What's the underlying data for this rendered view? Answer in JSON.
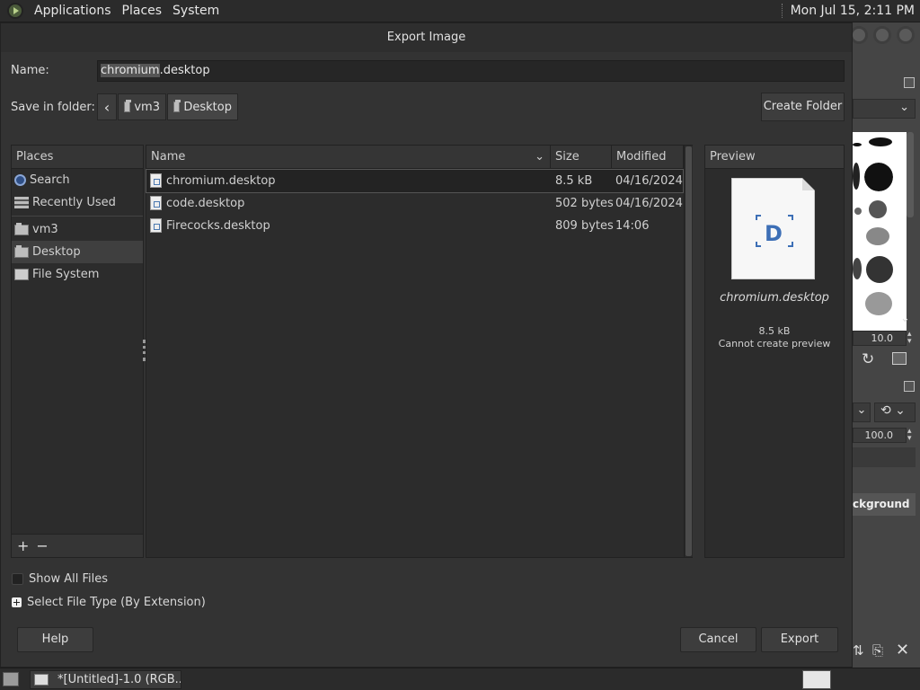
{
  "top_panel": {
    "menus": [
      "Applications",
      "Places",
      "System"
    ],
    "clock": "Mon Jul 15,  2:11 PM"
  },
  "dialog": {
    "title": "Export Image",
    "name_label": "Name:",
    "name_value_selected": "chromium",
    "name_value_rest": ".desktop",
    "save_in_label": "Save in folder:",
    "breadcrumbs": [
      "vm3",
      "Desktop"
    ],
    "create_folder": "Create Folder",
    "places": {
      "header": "Places",
      "items": [
        "Search",
        "Recently Used",
        "vm3",
        "Desktop",
        "File System"
      ],
      "selected": "Desktop",
      "add_label": "+",
      "remove_label": "−"
    },
    "files": {
      "columns": [
        "Name",
        "Size",
        "Modified"
      ],
      "rows": [
        {
          "name": "chromium.desktop",
          "size": "8.5 kB",
          "modified": "04/16/2024"
        },
        {
          "name": "code.desktop",
          "size": "502 bytes",
          "modified": "04/16/2024"
        },
        {
          "name": "Firecocks.desktop",
          "size": "809 bytes",
          "modified": "14:06"
        }
      ],
      "selected_row": 0
    },
    "preview": {
      "header": "Preview",
      "file_name": "chromium.desktop",
      "size": "8.5 kB",
      "message": "Cannot create preview"
    },
    "show_all_files": "Show All Files",
    "select_file_type": "Select File Type (By Extension)",
    "buttons": {
      "help": "Help",
      "cancel": "Cancel",
      "export": "Export"
    }
  },
  "dock": {
    "brush_size": "10.0",
    "opacity": "100.0",
    "layer_name": "ckground"
  },
  "taskbar": {
    "task": "*[Untitled]-1.0 (RGB..."
  }
}
